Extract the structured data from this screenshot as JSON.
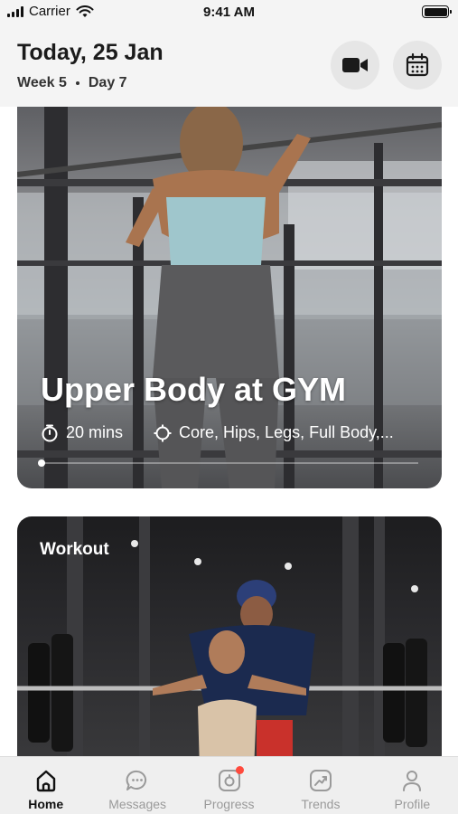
{
  "status_bar": {
    "carrier": "Carrier",
    "time": "9:41 AM"
  },
  "header": {
    "date_title": "Today, 25 Jan",
    "week": "Week 5",
    "day": "Day 7",
    "buttons": [
      {
        "icon": "video-camera-icon"
      },
      {
        "icon": "calendar-icon"
      }
    ]
  },
  "featured_card": {
    "title": "Upper Body at GYM",
    "duration": "20 mins",
    "focus": "Core, Hips, Legs, Full Body,..."
  },
  "workout_card": {
    "label": "Workout"
  },
  "tab_bar": {
    "items": [
      {
        "label": "Home",
        "icon": "home-icon",
        "active": true
      },
      {
        "label": "Messages",
        "icon": "chat-icon"
      },
      {
        "label": "Progress",
        "icon": "progress-icon",
        "badge": true
      },
      {
        "label": "Trends",
        "icon": "trends-icon"
      },
      {
        "label": "Profile",
        "icon": "person-icon"
      }
    ]
  },
  "colors": {
    "accent_badge": "#ff4a3d",
    "header_bg": "#f4f4f4"
  }
}
